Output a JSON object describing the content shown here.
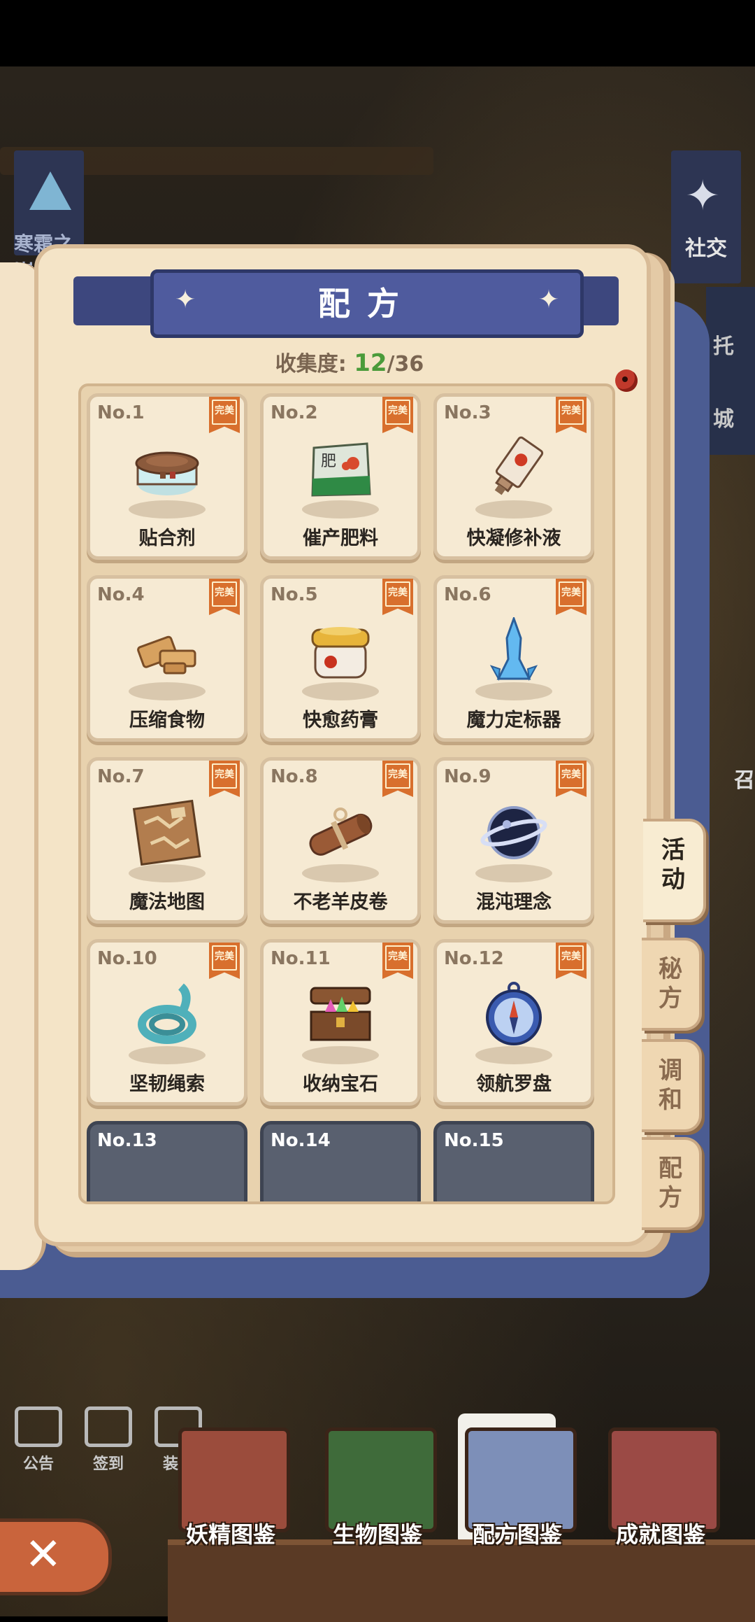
{
  "background": {
    "banner_left_label": "寒霜之巅",
    "banner_right_label": "社交",
    "side_strip_label": "托",
    "side_strip_label2": "城",
    "side_label_3": "召"
  },
  "book": {
    "title": "配方",
    "collection_label": "收集度:",
    "collection_count": "12",
    "collection_total": "/36",
    "badge_label": "完美"
  },
  "recipes": [
    {
      "no": "No.1",
      "name": "贴合剂",
      "icon": "glue-jar-icon",
      "completed": true
    },
    {
      "no": "No.2",
      "name": "催产肥料",
      "icon": "fertilizer-bag-icon",
      "completed": true
    },
    {
      "no": "No.3",
      "name": "快凝修补液",
      "icon": "repair-tube-icon",
      "completed": true
    },
    {
      "no": "No.4",
      "name": "压缩食物",
      "icon": "compressed-food-icon",
      "completed": true
    },
    {
      "no": "No.5",
      "name": "快愈药膏",
      "icon": "ointment-jar-icon",
      "completed": true
    },
    {
      "no": "No.6",
      "name": "魔力定标器",
      "icon": "crystal-marker-icon",
      "completed": true
    },
    {
      "no": "No.7",
      "name": "魔法地图",
      "icon": "magic-map-icon",
      "completed": true
    },
    {
      "no": "No.8",
      "name": "不老羊皮卷",
      "icon": "scroll-icon",
      "completed": true
    },
    {
      "no": "No.9",
      "name": "混沌理念",
      "icon": "chaos-orb-icon",
      "completed": true
    },
    {
      "no": "No.10",
      "name": "坚韧绳索",
      "icon": "rope-icon",
      "completed": true
    },
    {
      "no": "No.11",
      "name": "收纳宝石",
      "icon": "gem-chest-icon",
      "completed": true
    },
    {
      "no": "No.12",
      "name": "领航罗盘",
      "icon": "compass-icon",
      "completed": true
    },
    {
      "no": "No.13",
      "name": "",
      "icon": "locked-icon",
      "completed": false
    },
    {
      "no": "No.14",
      "name": "",
      "icon": "locked-icon",
      "completed": false
    },
    {
      "no": "No.15",
      "name": "",
      "icon": "locked-icon",
      "completed": false
    }
  ],
  "side_tabs": [
    {
      "label": "活动",
      "active": true
    },
    {
      "label": "秘方",
      "active": false
    },
    {
      "label": "调和",
      "active": false
    },
    {
      "label": "配方",
      "active": false
    }
  ],
  "quick_icons": [
    {
      "label": "公告",
      "icon": "bulletin-icon"
    },
    {
      "label": "签到",
      "icon": "checkin-icon"
    },
    {
      "label": "装饰",
      "icon": "decor-icon"
    }
  ],
  "bottom_nav": [
    {
      "label": "妖精图鉴",
      "icon": "fairy-book-icon",
      "color": "#9b4c3c",
      "active": false
    },
    {
      "label": "生物图鉴",
      "icon": "creature-book-icon",
      "color": "#3f6b3a",
      "active": false
    },
    {
      "label": "配方图鉴",
      "icon": "recipe-book-icon",
      "color": "#7d8fb8",
      "active": true
    },
    {
      "label": "成就图鉴",
      "icon": "achievement-book-icon",
      "color": "#9b4a45",
      "active": false
    }
  ],
  "close_button": {
    "label": "✕"
  }
}
